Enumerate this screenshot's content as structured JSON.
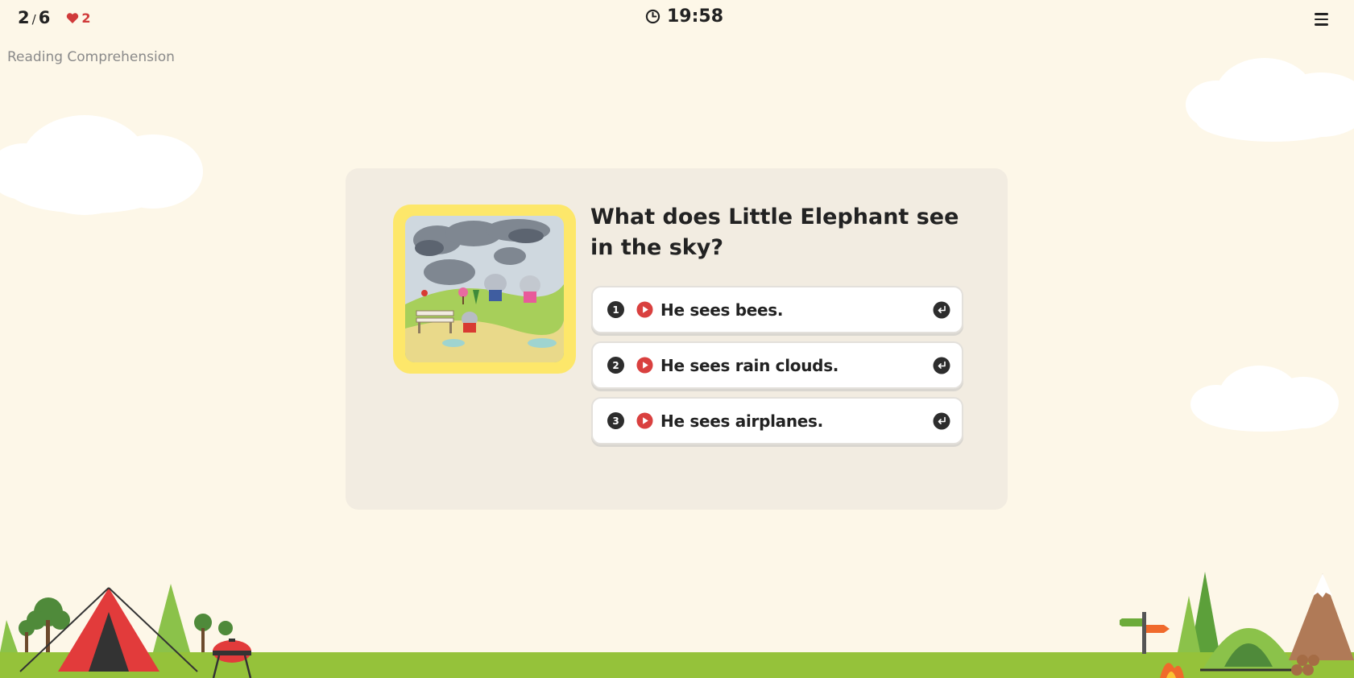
{
  "header": {
    "progress_current": "2",
    "progress_sep": "/",
    "progress_total": "6",
    "lives": "2",
    "subject": "Reading Comprehension",
    "timer": "19:58"
  },
  "question": {
    "text": "What does Little Elephant see in the sky?"
  },
  "options": [
    {
      "number": "1",
      "text": "He sees bees."
    },
    {
      "number": "2",
      "text": "He sees rain clouds."
    },
    {
      "number": "3",
      "text": "He sees airplanes."
    }
  ],
  "colors": {
    "background": "#fdf7e8",
    "card": "#f2ece1",
    "frame": "#fde76a",
    "heart": "#d03a3a",
    "play": "#d9403f",
    "grass": "#95c23a"
  },
  "icons": {
    "lives": "heart-icon",
    "timer": "clock-icon",
    "menu": "menu-icon",
    "play": "play-audio-icon",
    "enter": "enter-icon"
  }
}
